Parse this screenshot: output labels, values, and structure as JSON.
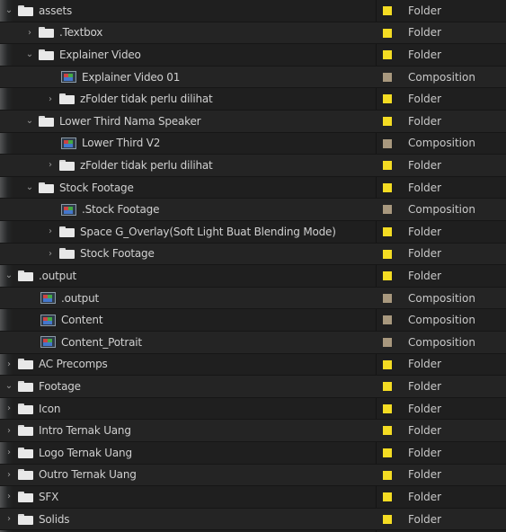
{
  "colors": {
    "folder_label": "#f4dc23",
    "composition_label": "#a8987e"
  },
  "rows": [
    {
      "name": "assets",
      "type": "Folder",
      "kind": "folder",
      "expanded": true,
      "depth": 0
    },
    {
      "name": ".Textbox",
      "type": "Folder",
      "kind": "folder",
      "expanded": false,
      "depth": 1
    },
    {
      "name": "Explainer Video",
      "type": "Folder",
      "kind": "folder",
      "expanded": true,
      "depth": 1
    },
    {
      "name": "Explainer Video 01",
      "type": "Composition",
      "kind": "comp",
      "expanded": null,
      "depth": 2
    },
    {
      "name": "zFolder tidak perlu dilihat",
      "type": "Folder",
      "kind": "folder",
      "expanded": false,
      "depth": 2
    },
    {
      "name": "Lower Third Nama Speaker",
      "type": "Folder",
      "kind": "folder",
      "expanded": true,
      "depth": 1
    },
    {
      "name": "Lower Third V2",
      "type": "Composition",
      "kind": "comp",
      "expanded": null,
      "depth": 2
    },
    {
      "name": "zFolder tidak perlu dilihat",
      "type": "Folder",
      "kind": "folder",
      "expanded": false,
      "depth": 2
    },
    {
      "name": "Stock Footage",
      "type": "Folder",
      "kind": "folder",
      "expanded": true,
      "depth": 1
    },
    {
      "name": ".Stock Footage",
      "type": "Composition",
      "kind": "comp",
      "expanded": null,
      "depth": 2
    },
    {
      "name": "Space G_Overlay(Soft Light Buat Blending Mode)",
      "type": "Folder",
      "kind": "folder",
      "expanded": false,
      "depth": 2
    },
    {
      "name": "Stock Footage",
      "type": "Folder",
      "kind": "folder",
      "expanded": false,
      "depth": 2
    },
    {
      "name": ".output",
      "type": "Folder",
      "kind": "folder",
      "expanded": true,
      "depth": 0
    },
    {
      "name": ".output",
      "type": "Composition",
      "kind": "comp",
      "expanded": null,
      "depth": 1
    },
    {
      "name": "Content",
      "type": "Composition",
      "kind": "comp",
      "expanded": null,
      "depth": 1
    },
    {
      "name": "Content_Potrait",
      "type": "Composition",
      "kind": "comp",
      "expanded": null,
      "depth": 1
    },
    {
      "name": "AC Precomps",
      "type": "Folder",
      "kind": "folder",
      "expanded": false,
      "depth": 0
    },
    {
      "name": "Footage",
      "type": "Folder",
      "kind": "folder",
      "expanded": true,
      "depth": 0
    },
    {
      "name": "Icon",
      "type": "Folder",
      "kind": "folder",
      "expanded": false,
      "depth": 0
    },
    {
      "name": "Intro Ternak Uang",
      "type": "Folder",
      "kind": "folder",
      "expanded": false,
      "depth": 0
    },
    {
      "name": "Logo Ternak Uang",
      "type": "Folder",
      "kind": "folder",
      "expanded": false,
      "depth": 0
    },
    {
      "name": "Outro Ternak Uang",
      "type": "Folder",
      "kind": "folder",
      "expanded": false,
      "depth": 0
    },
    {
      "name": "SFX",
      "type": "Folder",
      "kind": "folder",
      "expanded": false,
      "depth": 0
    },
    {
      "name": "Solids",
      "type": "Folder",
      "kind": "folder",
      "expanded": false,
      "depth": 0
    }
  ]
}
